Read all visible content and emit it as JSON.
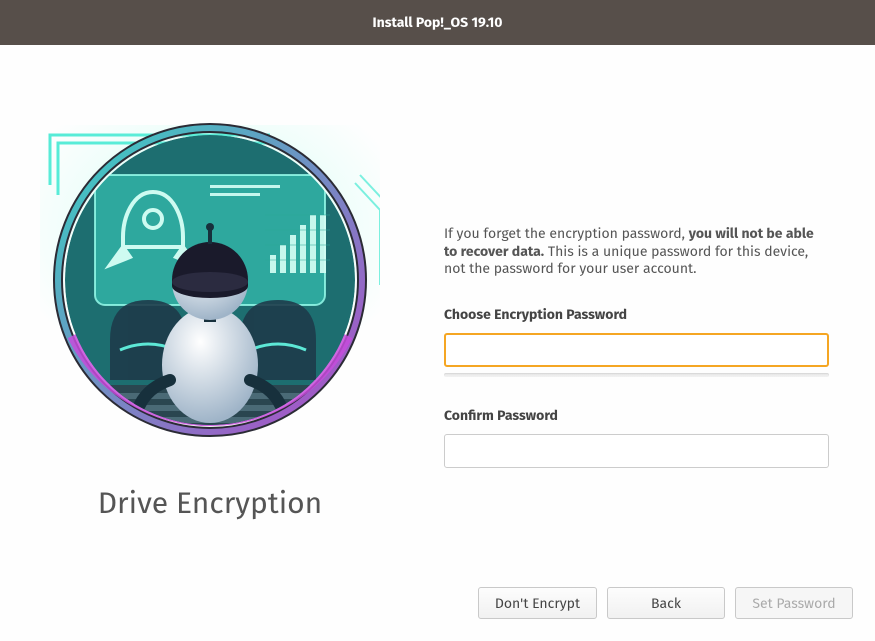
{
  "titlebar": {
    "title": "Install Pop!_OS 19.10"
  },
  "left": {
    "page_title": "Drive Encryption"
  },
  "info": {
    "pre": "If you forget the encryption password, ",
    "bold": "you will not be able to recover data.",
    "post": " This is a unique password for this device, not the password for your user account."
  },
  "fields": {
    "choose": {
      "label": "Choose Encryption Password",
      "value": ""
    },
    "confirm": {
      "label": "Confirm Password",
      "value": ""
    }
  },
  "buttons": {
    "dont_encrypt": "Don't Encrypt",
    "back": "Back",
    "set_password": "Set Password"
  }
}
